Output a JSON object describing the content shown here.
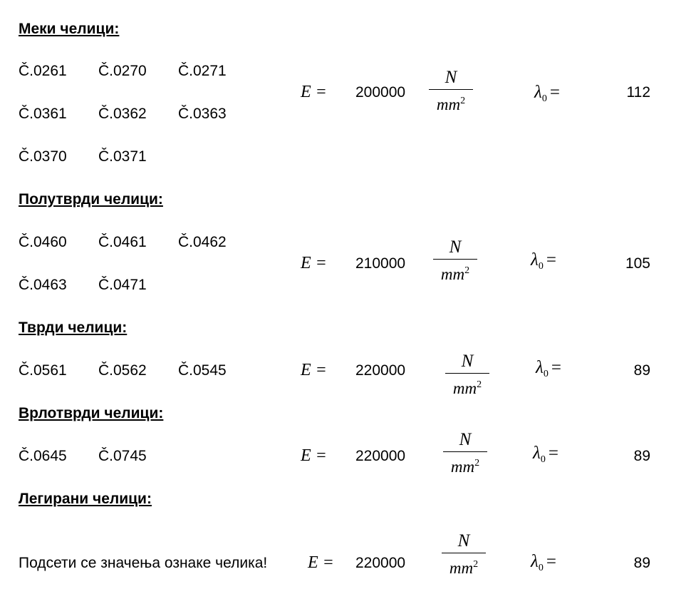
{
  "sections": [
    {
      "heading": "Меки челици:",
      "grades": [
        [
          "Č.0261",
          "Č.0270",
          "Č.0271"
        ],
        [
          "Č.0361",
          "Č.0362",
          "Č.0363"
        ],
        [
          "Č.0370",
          "Č.0371"
        ]
      ],
      "e_label": "E =",
      "e_value": "200000",
      "unit_num": "N",
      "unit_den": "mm",
      "unit_exp": "2",
      "lambda_sym": "λ",
      "lambda_sub": "0",
      "lambda_eq": "=",
      "lambda_value": "112"
    },
    {
      "heading": "Полутврди челици:",
      "grades": [
        [
          "Č.0460",
          "Č.0461",
          "Č.0462"
        ],
        [
          "Č.0463",
          "Č.0471"
        ]
      ],
      "e_label": "E =",
      "e_value": "210000",
      "unit_num": "N",
      "unit_den": "mm",
      "unit_exp": "2",
      "lambda_sym": "λ",
      "lambda_sub": "0",
      "lambda_eq": "=",
      "lambda_value": "105"
    },
    {
      "heading": "Тврди челици:",
      "grades": [
        [
          "Č.0561",
          "Č.0562",
          "Č.0545"
        ]
      ],
      "e_label": "E =",
      "e_value": "220000",
      "unit_num": "N",
      "unit_den": "mm",
      "unit_exp": "2",
      "lambda_sym": "λ",
      "lambda_sub": "0",
      "lambda_eq": "=",
      "lambda_value": "89"
    },
    {
      "heading": "Врлотврди челици:",
      "grades": [
        [
          "Č.0645",
          "Č.0745"
        ]
      ],
      "e_label": "E =",
      "e_value": "220000",
      "unit_num": "N",
      "unit_den": "mm",
      "unit_exp": "2",
      "lambda_sym": "λ",
      "lambda_sub": "0",
      "lambda_eq": "=",
      "lambda_value": "89"
    },
    {
      "heading": "Легирани челици:",
      "note": "Подсети се значења ознаке челика!",
      "e_label": "E =",
      "e_value": "220000",
      "unit_num": "N",
      "unit_den": "mm",
      "unit_exp": "2",
      "lambda_sym": "λ",
      "lambda_sub": "0",
      "lambda_eq": "=",
      "lambda_value": "89"
    }
  ]
}
